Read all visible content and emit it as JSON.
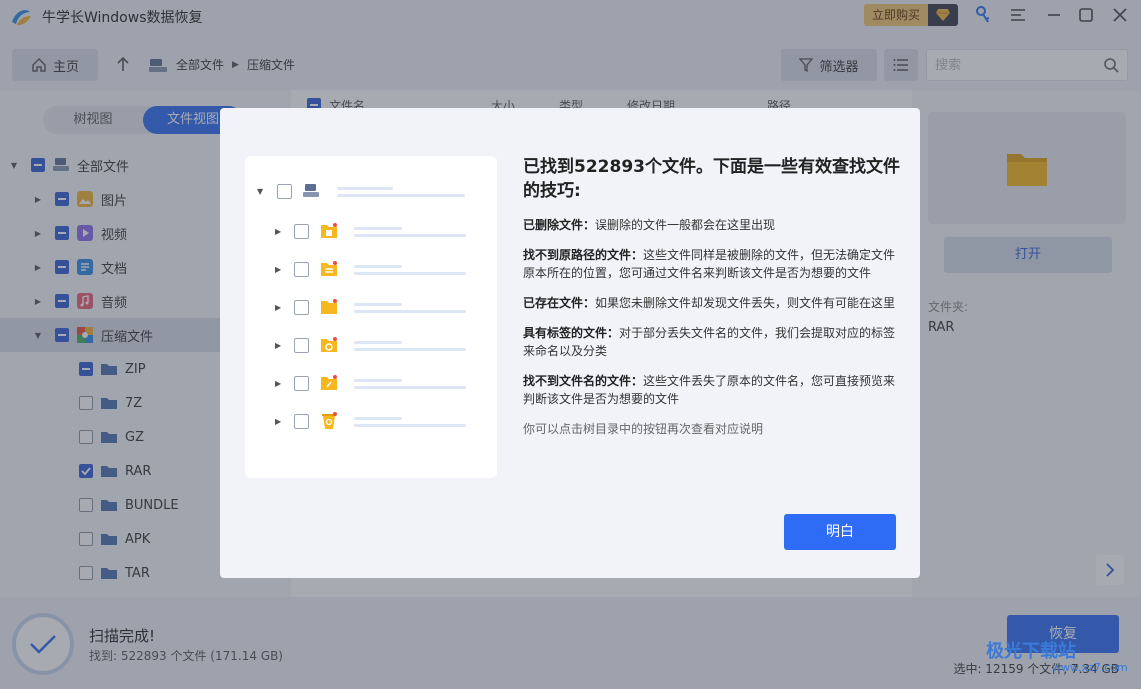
{
  "app": {
    "title": "牛学长Windows数据恢复",
    "buy_label": "立即购买"
  },
  "toolbar": {
    "home_label": "主页",
    "breadcrumb": [
      "全部文件",
      "压缩文件"
    ],
    "filter_label": "筛选器",
    "search_placeholder": "搜索"
  },
  "left": {
    "view_tabs": [
      "树视图",
      "文件视图"
    ],
    "tree": [
      {
        "label": "全部文件",
        "level": 0
      },
      {
        "label": "图片",
        "level": 1
      },
      {
        "label": "视频",
        "level": 1
      },
      {
        "label": "文档",
        "level": 1
      },
      {
        "label": "音频",
        "level": 1
      },
      {
        "label": "压缩文件",
        "level": 1
      },
      {
        "label": "ZIP",
        "level": 2
      },
      {
        "label": "7Z",
        "level": 2
      },
      {
        "label": "GZ",
        "level": 2
      },
      {
        "label": "RAR",
        "level": 2
      },
      {
        "label": "BUNDLE",
        "level": 2
      },
      {
        "label": "APK",
        "level": 2
      },
      {
        "label": "TAR",
        "level": 2
      }
    ]
  },
  "table": {
    "columns": [
      "文件名",
      "大小",
      "类型",
      "修改日期",
      "路径"
    ]
  },
  "right": {
    "open_label": "打开",
    "folder_label": "文件夹:",
    "folder_value": "RAR"
  },
  "bottom": {
    "scan_title": "扫描完成!",
    "scan_sub": "找到: 522893 个文件 (171.14 GB)",
    "recover_label": "恢复",
    "selected_info": "选中: 12159 个文件, 7.34 GB",
    "watermark": "极光下载站",
    "watermark_sub": "www.xz7.com"
  },
  "dialog": {
    "title": "已找到522893个文件。下面是一些有效查找文件的技巧:",
    "tips": [
      {
        "head": "已删除文件：",
        "body": "误删除的文件一般都会在这里出现"
      },
      {
        "head": "找不到原路径的文件：",
        "body": "这些文件同样是被删除的文件，但无法确定文件原本所在的位置，您可通过文件名来判断该文件是否为想要的文件"
      },
      {
        "head": "已存在文件：",
        "body": "如果您未删除文件却发现文件丢失，则文件有可能在这里"
      },
      {
        "head": "具有标签的文件：",
        "body": "对于部分丢失文件名的文件，我们会提取对应的标签来命名以及分类"
      },
      {
        "head": "找不到文件名的文件：",
        "body": "这些文件丢失了原本的文件名，您可直接预览来判断该文件是否为想要的文件"
      }
    ],
    "footer": "你可以点击树目录中的按钮再次查看对应说明",
    "ok_label": "明白"
  }
}
